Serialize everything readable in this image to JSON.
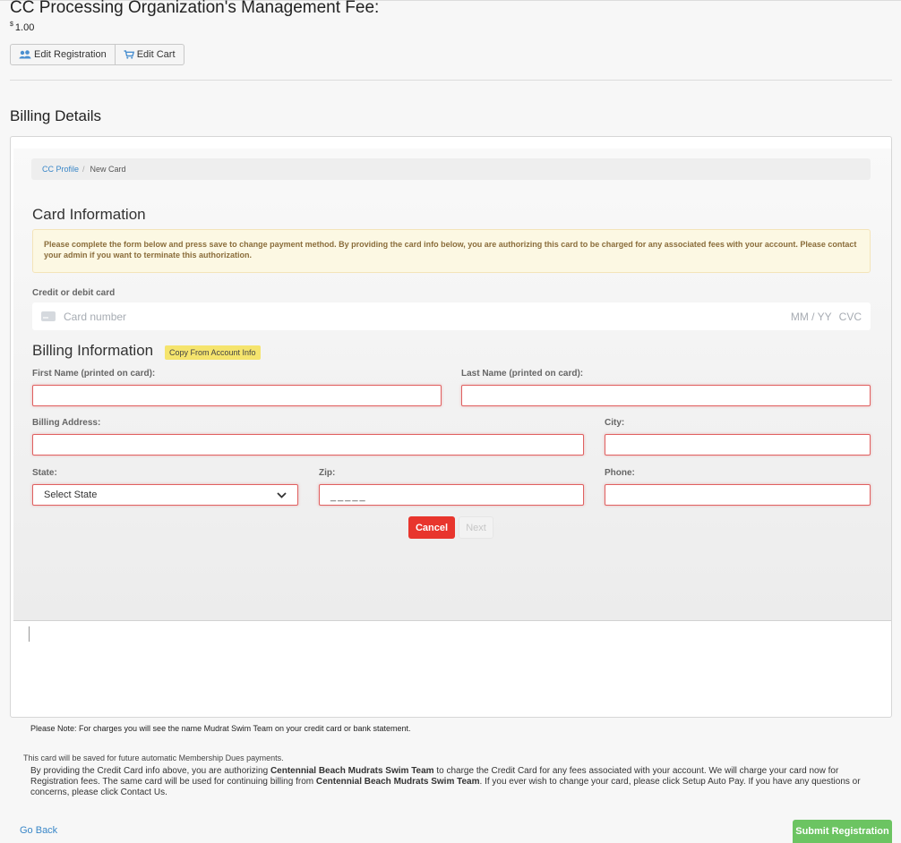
{
  "fee": {
    "title": "CC Processing Organization's Management Fee:",
    "currency": "$",
    "amount": "1.00"
  },
  "actions": {
    "edit_registration": "Edit Registration",
    "edit_cart": "Edit Cart"
  },
  "billing": {
    "section_title": "Billing Details"
  },
  "breadcrumb": {
    "link": "CC Profile",
    "separator": "/",
    "current": "New Card"
  },
  "card": {
    "title": "Card Information",
    "warning": "Please complete the form below and press save to change payment method. By providing the card info below, you are authorizing this card to be charged for any associated fees with your account. Please contact your admin if you want to terminate this authorization.",
    "credit_label": "Credit or debit card",
    "number_placeholder": "Card number",
    "date_placeholder": "MM / YY",
    "cvc_placeholder": "CVC",
    "icon": "credit-card-icon"
  },
  "billing_info": {
    "title": "Billing Information",
    "copy_button": "Copy From Account Info",
    "first_name_label": "First Name (printed on card):",
    "last_name_label": "Last Name (printed on card):",
    "address_label": "Billing Address:",
    "city_label": "City:",
    "state_label": "State:",
    "state_value": "Select State",
    "zip_label": "Zip:",
    "zip_value": "_____",
    "phone_label": "Phone:",
    "error_border_color": "#e06060"
  },
  "form_buttons": {
    "cancel": "Cancel",
    "next": "Next"
  },
  "notes": {
    "statement": "Please Note: For charges you will see the name Mudrat Swim Team on your credit card or bank statement.",
    "saved": "This card will be saved for future automatic Membership Dues payments.",
    "auth_1": "By providing the Credit Card info above, you are authorizing ",
    "org_1": "Centennial Beach Mudrats Swim Team",
    "auth_2": " to charge the Credit Card for any fees associated with your account. We will charge your card now for Registration fees. The same card will be used for continuing billing from ",
    "org_2": "Centennial Beach Mudrats Swim Team",
    "auth_3": ". If you ever wish to change your card, please click Setup Auto Pay. If you have any questions or concerns, please click Contact Us."
  },
  "footer": {
    "go_back": "Go Back",
    "submit": "Submit Registration"
  },
  "colors": {
    "link": "#3a87c8",
    "cancel": "#e8352d",
    "submit": "#6cc462",
    "copy_button": "#f5e46d",
    "warning_bg": "#fcf8e3"
  }
}
